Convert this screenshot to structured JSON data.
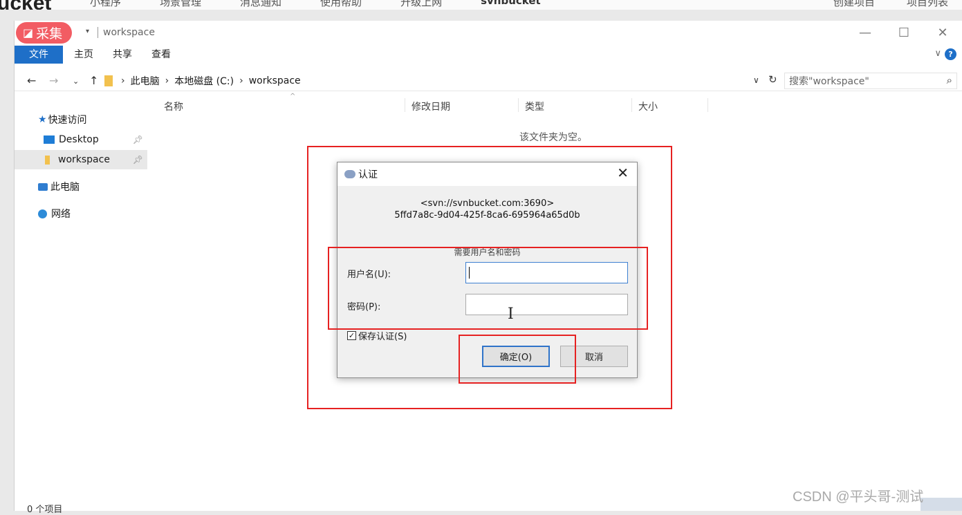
{
  "bg": {
    "logo_fragment": "ucket",
    "nav": [
      "小程序",
      "场景管理",
      "消息通知",
      "使用帮助",
      "升级上网",
      "svnbucket"
    ],
    "right": [
      "创建项目",
      "项目列表"
    ]
  },
  "collect_badge": "采集",
  "window": {
    "title": "workspace",
    "controls": {
      "minimize": "—",
      "maximize": "☐",
      "close": "✕"
    }
  },
  "ribbon": {
    "tabs": [
      "文件",
      "主页",
      "共享",
      "查看"
    ]
  },
  "address": {
    "crumbs": [
      "此电脑",
      "本地磁盘 (C:)",
      "workspace"
    ],
    "search_placeholder": "搜索\"workspace\""
  },
  "nav_pane": {
    "quick_access": "快速访问",
    "desktop": "Desktop",
    "workspace": "workspace",
    "this_pc": "此电脑",
    "network": "网络"
  },
  "columns": {
    "name": "名称",
    "modified": "修改日期",
    "type": "类型",
    "size": "大小"
  },
  "empty_message": "该文件夹为空。",
  "status": "0 个项目",
  "watermark": "CSDN @平头哥-测试",
  "dialog": {
    "title": "认证",
    "realm_line1": "<svn://svnbucket.com:3690>",
    "realm_line2": "5ffd7a8c-9d04-425f-8ca6-695964a65d0b",
    "prompt": "需要用户名和密码",
    "username_label": "用户名(U):",
    "password_label": "密码(P):",
    "username_value": "",
    "password_value": "",
    "save_auth_label": "保存认证(S)",
    "save_auth_checked": true,
    "ok_label": "确定(O)",
    "cancel_label": "取消"
  }
}
